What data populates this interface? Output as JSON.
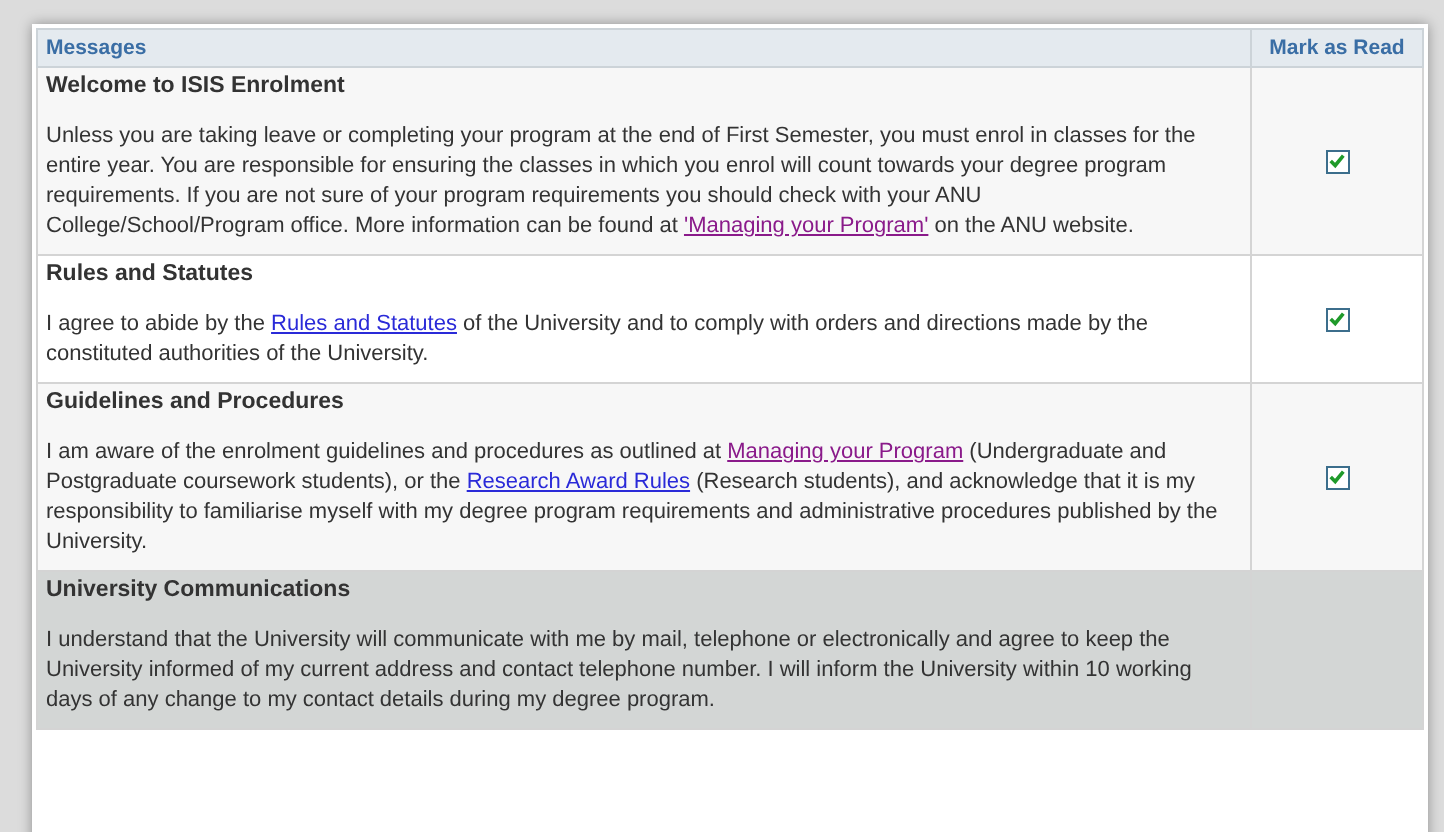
{
  "table": {
    "columns": [
      "Messages",
      "Mark as Read"
    ],
    "rows": [
      {
        "title": "Welcome to ISIS Enrolment",
        "selected": false,
        "checked": true,
        "body": [
          {
            "text": "Unless you are taking leave or completing your program at the end of First Semester, you must enrol in classes for the entire year. You are responsible for ensuring the classes in which you enrol will count towards your degree program requirements. If you are not sure of your program requirements you should check with your ANU College/School/Program office. More information can be found at "
          },
          {
            "link": "'Managing your Program'",
            "visited": true
          },
          {
            "text": " on the ANU website."
          }
        ]
      },
      {
        "title": "Rules and Statutes",
        "selected": false,
        "checked": true,
        "body": [
          {
            "text": "I agree to abide by the "
          },
          {
            "link": "Rules and Statutes",
            "visited": false
          },
          {
            "text": " of the University and to comply with orders and directions made by the constituted authorities of the University."
          }
        ]
      },
      {
        "title": "Guidelines and Procedures",
        "selected": false,
        "checked": true,
        "body": [
          {
            "text": "I am aware of the enrolment guidelines and procedures as outlined at "
          },
          {
            "link": "Managing your Program",
            "visited": true
          },
          {
            "text": " (Undergraduate and Postgraduate coursework students), or the "
          },
          {
            "link": "Research Award Rules",
            "visited": false
          },
          {
            "text": " (Research students), and acknowledge that it is my responsibility to familiarise myself with my degree program requirements and administrative procedures published by the University."
          }
        ]
      },
      {
        "title": "University Communications",
        "selected": true,
        "body": [
          {
            "text": "I understand that the University will communicate with me by mail, telephone or electronically and agree to keep the University informed of my current address and contact telephone number. I will inform the University within 10 working days of any change to my contact details during my degree program."
          }
        ]
      }
    ]
  }
}
